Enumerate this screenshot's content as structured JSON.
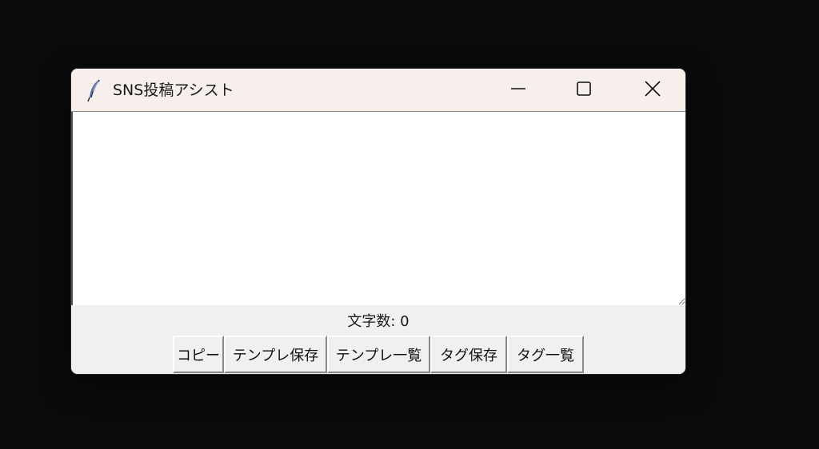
{
  "window": {
    "title": "SNS投稿アシスト",
    "icon": "feather-icon",
    "controls": {
      "minimize_icon": "minimize-icon",
      "maximize_icon": "maximize-icon",
      "close_icon": "close-icon"
    }
  },
  "editor": {
    "value": ""
  },
  "status": {
    "char_count_label": "文字数: 0"
  },
  "buttons": {
    "copy": "コピー",
    "save_template": "テンプレ保存",
    "template_list": "テンプレ一覧",
    "save_tag": "タグ保存",
    "tag_list": "タグ一覧"
  },
  "colors": {
    "titlebar_bg": "#f7efec",
    "panel_bg": "#f0f0f0",
    "desktop_bg": "#0b0b0b"
  }
}
